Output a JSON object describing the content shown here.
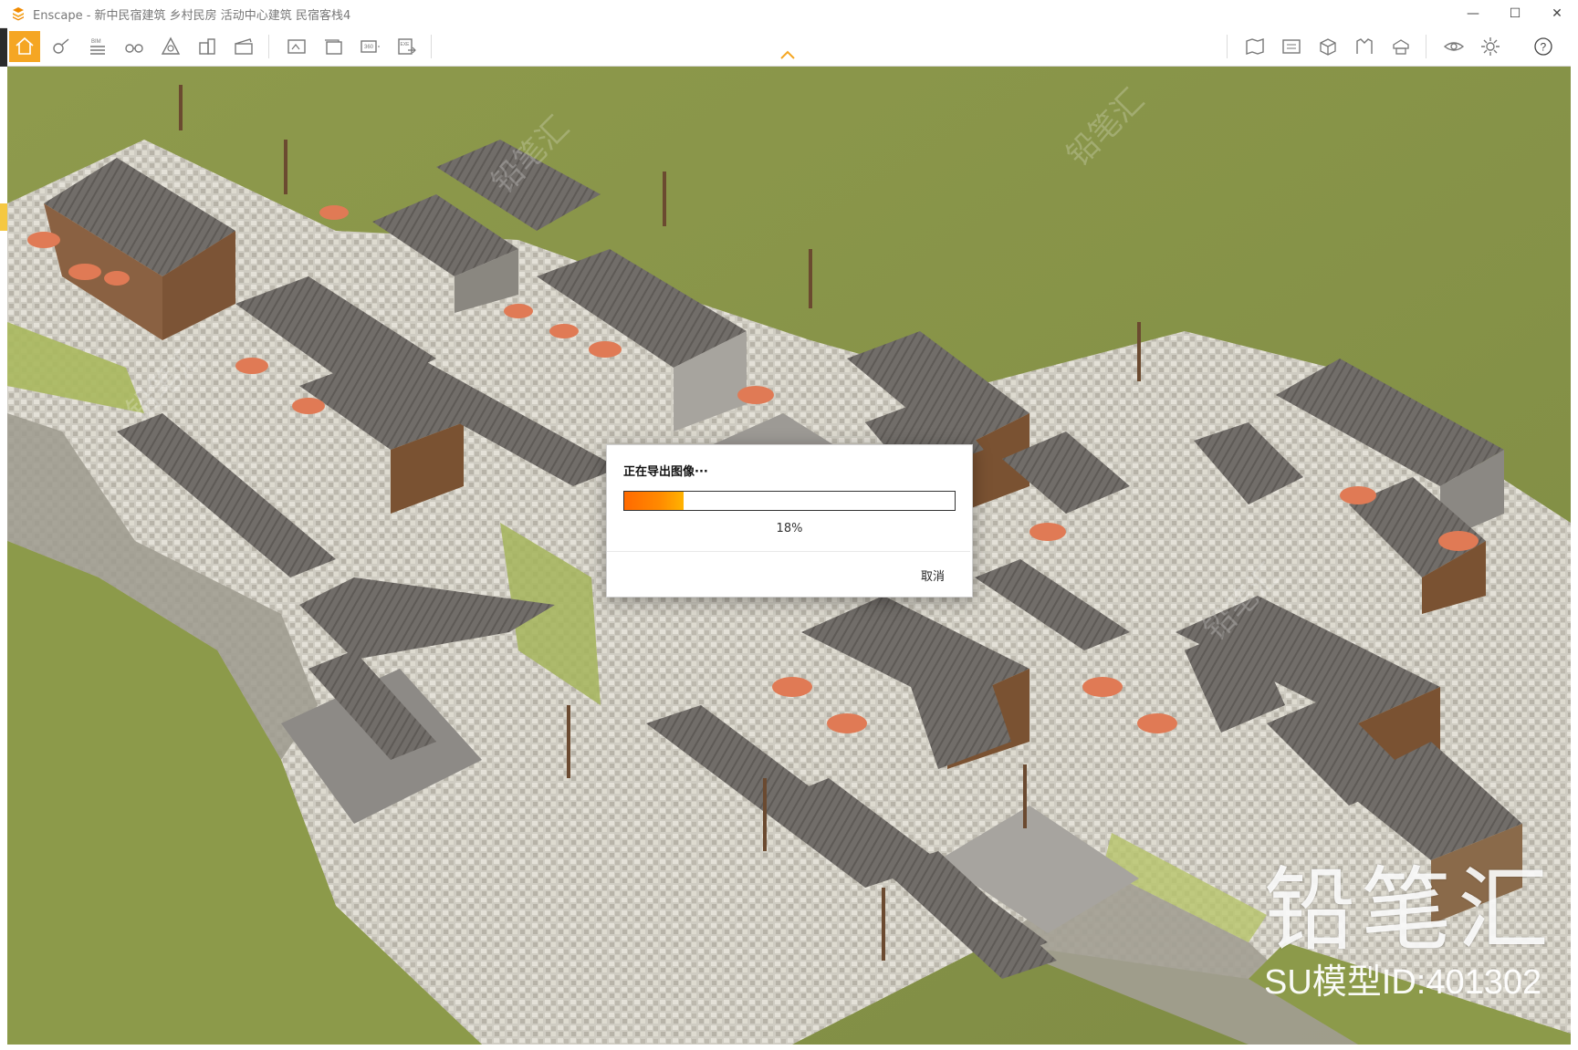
{
  "window": {
    "title": "Enscape - 新中民宿建筑 乡村民房 活动中心建筑 民宿客栈4",
    "minimize_glyph": "—",
    "maximize_glyph": "☐",
    "close_glyph": "✕"
  },
  "toolbar": {
    "left_buttons": [
      {
        "name": "home-icon",
        "active": true
      },
      {
        "name": "walk-mode-icon",
        "active": false
      },
      {
        "name": "bim-icon",
        "label": "BIM",
        "active": false
      },
      {
        "name": "binoculars-icon",
        "active": false
      },
      {
        "name": "material-icon",
        "active": false
      },
      {
        "name": "asset-library-icon",
        "active": false
      },
      {
        "name": "video-editor-icon",
        "active": false
      },
      {
        "name": "screenshot-icon",
        "active": false
      },
      {
        "name": "batch-render-icon",
        "active": false
      },
      {
        "name": "panorama-360-icon",
        "label": "360",
        "active": false
      },
      {
        "name": "export-exe-icon",
        "label": "EXE",
        "active": false
      }
    ],
    "right_buttons": [
      {
        "name": "map-icon"
      },
      {
        "name": "uploads-icon"
      },
      {
        "name": "box-view-icon"
      },
      {
        "name": "clipping-icon"
      },
      {
        "name": "capture-icon"
      },
      {
        "name": "visual-settings-icon"
      },
      {
        "name": "settings-gear-icon"
      },
      {
        "name": "help-icon",
        "label": "?"
      }
    ]
  },
  "dialog": {
    "title": "正在导出图像···",
    "progress_percent": 18,
    "progress_label": "18%",
    "cancel_label": "取消",
    "accent_color": "#ff7a00"
  },
  "watermark": {
    "brand": "铅笔汇",
    "model_id": "SU模型ID:401302"
  },
  "colors": {
    "grass": "#8c9a4a",
    "roof": "#6e6a66",
    "stone": "#c9c6bc",
    "wood": "#8a5a36",
    "umbrella": "#e07a55"
  }
}
